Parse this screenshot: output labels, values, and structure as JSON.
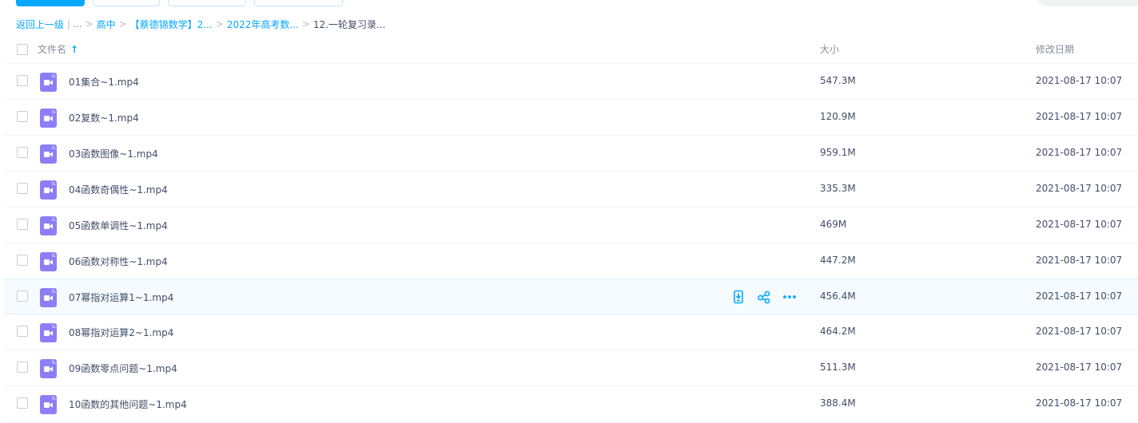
{
  "breadcrumb": {
    "back": "返回上一级",
    "bar": "|",
    "ellipsis": "...",
    "sep": ">",
    "items": [
      "高中",
      "【蔡德锦数学】2...",
      "2022年高考数..."
    ],
    "current": "12.一轮复习录..."
  },
  "header": {
    "name": "文件名",
    "sort_arrow": "↑",
    "size": "大小",
    "date": "修改日期"
  },
  "colors": {
    "accent": "#06a7ff",
    "video_icon": "#8c7ef8",
    "hover_row": "#f5fbfe"
  },
  "files": [
    {
      "name": "01集合~1.mp4",
      "size": "547.3M",
      "date": "2021-08-17 10:07"
    },
    {
      "name": "02复数~1.mp4",
      "size": "120.9M",
      "date": "2021-08-17 10:07"
    },
    {
      "name": "03函数图像~1.mp4",
      "size": "959.1M",
      "date": "2021-08-17 10:07"
    },
    {
      "name": "04函数奇偶性~1.mp4",
      "size": "335.3M",
      "date": "2021-08-17 10:07"
    },
    {
      "name": "05函数单调性~1.mp4",
      "size": "469M",
      "date": "2021-08-17 10:07"
    },
    {
      "name": "06函数对称性~1.mp4",
      "size": "447.2M",
      "date": "2021-08-17 10:07"
    },
    {
      "name": "07幂指对运算1~1.mp4",
      "size": "456.4M",
      "date": "2021-08-17 10:07"
    },
    {
      "name": "08幂指对运算2~1.mp4",
      "size": "464.2M",
      "date": "2021-08-17 10:07"
    },
    {
      "name": "09函数零点问题~1.mp4",
      "size": "511.3M",
      "date": "2021-08-17 10:07"
    },
    {
      "name": "10函数的其他问题~1.mp4",
      "size": "388.4M",
      "date": "2021-08-17 10:07"
    }
  ]
}
